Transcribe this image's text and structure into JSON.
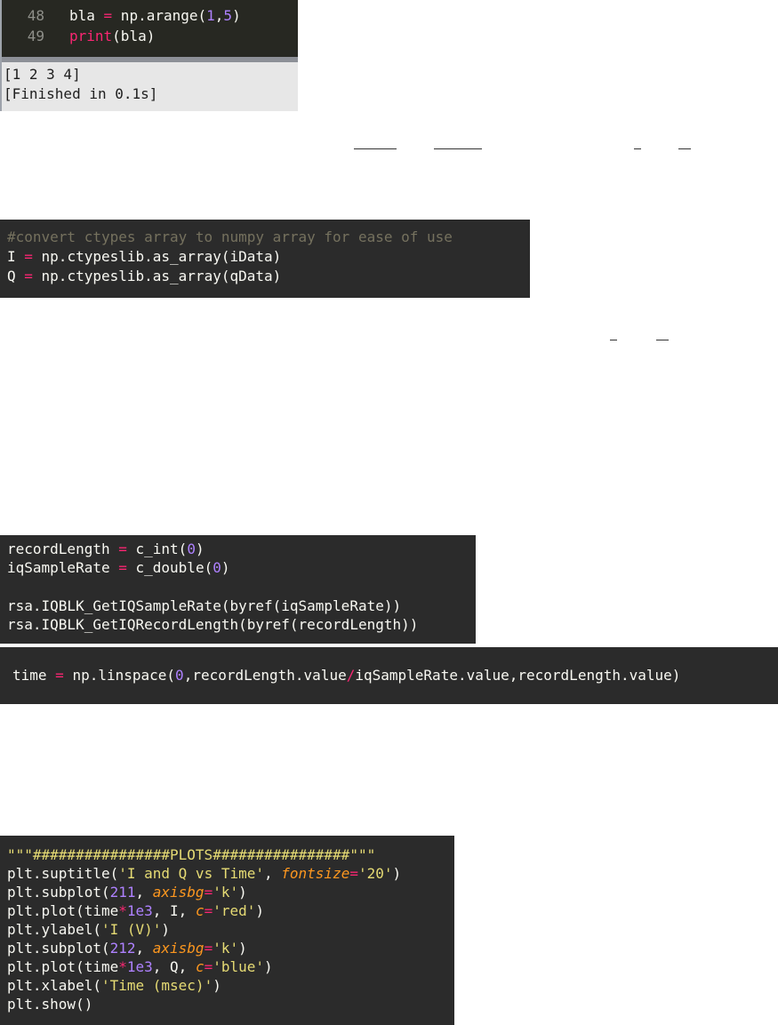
{
  "sublime": {
    "lines": [
      {
        "num": "48",
        "parts": [
          {
            "t": "bla ",
            "c": ""
          },
          {
            "t": "=",
            "c": "k"
          },
          {
            "t": " np.arange(",
            "c": ""
          },
          {
            "t": "1",
            "c": "n"
          },
          {
            "t": ",",
            "c": ""
          },
          {
            "t": "5",
            "c": "n"
          },
          {
            "t": ")",
            "c": ""
          }
        ]
      },
      {
        "num": "49",
        "parts": [
          {
            "t": "print",
            "c": "k"
          },
          {
            "t": "(bla)",
            "c": ""
          }
        ]
      }
    ],
    "output": [
      "[1 2 3 4]",
      "[Finished in 0.1s]"
    ]
  },
  "block_convert": {
    "lines": [
      [
        {
          "t": "#convert ctypes array to numpy array for ease of use",
          "c": "c"
        }
      ],
      [
        {
          "t": "I ",
          "c": ""
        },
        {
          "t": "=",
          "c": "k"
        },
        {
          "t": " np.ctypeslib.as_array(iData)",
          "c": ""
        }
      ],
      [
        {
          "t": "Q ",
          "c": ""
        },
        {
          "t": "=",
          "c": "k"
        },
        {
          "t": " np.ctypeslib.as_array(qData)",
          "c": ""
        }
      ]
    ]
  },
  "block_record": {
    "lines": [
      [
        {
          "t": "recordLength ",
          "c": ""
        },
        {
          "t": "=",
          "c": "k"
        },
        {
          "t": " c_int(",
          "c": ""
        },
        {
          "t": "0",
          "c": "n"
        },
        {
          "t": ")",
          "c": ""
        }
      ],
      [
        {
          "t": "iqSampleRate ",
          "c": ""
        },
        {
          "t": "=",
          "c": "k"
        },
        {
          "t": " c_double(",
          "c": ""
        },
        {
          "t": "0",
          "c": "n"
        },
        {
          "t": ")",
          "c": ""
        }
      ],
      [
        {
          "t": "",
          "c": ""
        }
      ],
      [
        {
          "t": "rsa.IQBLK_GetIQSampleRate(byref(iqSampleRate))",
          "c": ""
        }
      ],
      [
        {
          "t": "rsa.IQBLK_GetIQRecordLength(byref(recordLength))",
          "c": ""
        }
      ]
    ]
  },
  "block_time": {
    "lines": [
      [
        {
          "t": "time ",
          "c": ""
        },
        {
          "t": "=",
          "c": "k"
        },
        {
          "t": " np.linspace(",
          "c": ""
        },
        {
          "t": "0",
          "c": "n"
        },
        {
          "t": ",recordLength.value",
          "c": ""
        },
        {
          "t": "/",
          "c": "k"
        },
        {
          "t": "iqSampleRate.value,recordLength.value)",
          "c": ""
        }
      ]
    ]
  },
  "block_plots": {
    "lines": [
      [
        {
          "t": "\"\"\"################PLOTS################\"\"\"",
          "c": "s"
        }
      ],
      [
        {
          "t": "plt.suptitle(",
          "c": ""
        },
        {
          "t": "'I and Q vs Time'",
          "c": "s"
        },
        {
          "t": ", ",
          "c": ""
        },
        {
          "t": "fontsize",
          "c": "a"
        },
        {
          "t": "=",
          "c": "k"
        },
        {
          "t": "'20'",
          "c": "s"
        },
        {
          "t": ")",
          "c": ""
        }
      ],
      [
        {
          "t": "plt.subplot(",
          "c": ""
        },
        {
          "t": "211",
          "c": "n"
        },
        {
          "t": ", ",
          "c": ""
        },
        {
          "t": "axisbg",
          "c": "a"
        },
        {
          "t": "=",
          "c": "k"
        },
        {
          "t": "'k'",
          "c": "s"
        },
        {
          "t": ")",
          "c": ""
        }
      ],
      [
        {
          "t": "plt.plot(time",
          "c": ""
        },
        {
          "t": "*",
          "c": "k"
        },
        {
          "t": "1e3",
          "c": "n"
        },
        {
          "t": ", I, ",
          "c": ""
        },
        {
          "t": "c",
          "c": "a"
        },
        {
          "t": "=",
          "c": "k"
        },
        {
          "t": "'red'",
          "c": "s"
        },
        {
          "t": ")",
          "c": ""
        }
      ],
      [
        {
          "t": "plt.ylabel(",
          "c": ""
        },
        {
          "t": "'I (V)'",
          "c": "s"
        },
        {
          "t": ")",
          "c": ""
        }
      ],
      [
        {
          "t": "plt.subplot(",
          "c": ""
        },
        {
          "t": "212",
          "c": "n"
        },
        {
          "t": ", ",
          "c": ""
        },
        {
          "t": "axisbg",
          "c": "a"
        },
        {
          "t": "=",
          "c": "k"
        },
        {
          "t": "'k'",
          "c": "s"
        },
        {
          "t": ")",
          "c": ""
        }
      ],
      [
        {
          "t": "plt.plot(time",
          "c": ""
        },
        {
          "t": "*",
          "c": "k"
        },
        {
          "t": "1e3",
          "c": "n"
        },
        {
          "t": ", Q, ",
          "c": ""
        },
        {
          "t": "c",
          "c": "a"
        },
        {
          "t": "=",
          "c": "k"
        },
        {
          "t": "'blue'",
          "c": "s"
        },
        {
          "t": ")",
          "c": ""
        }
      ],
      [
        {
          "t": "plt.xlabel(",
          "c": ""
        },
        {
          "t": "'Time (msec)'",
          "c": "s"
        },
        {
          "t": ")",
          "c": ""
        }
      ],
      [
        {
          "t": "plt.show()",
          "c": ""
        }
      ]
    ]
  },
  "colors": {
    "keyword": "#f92672",
    "number": "#ae81ff",
    "string": "#e6db74",
    "comment": "#75715e",
    "argument": "#fd971f",
    "background": "#2b2b2b"
  }
}
